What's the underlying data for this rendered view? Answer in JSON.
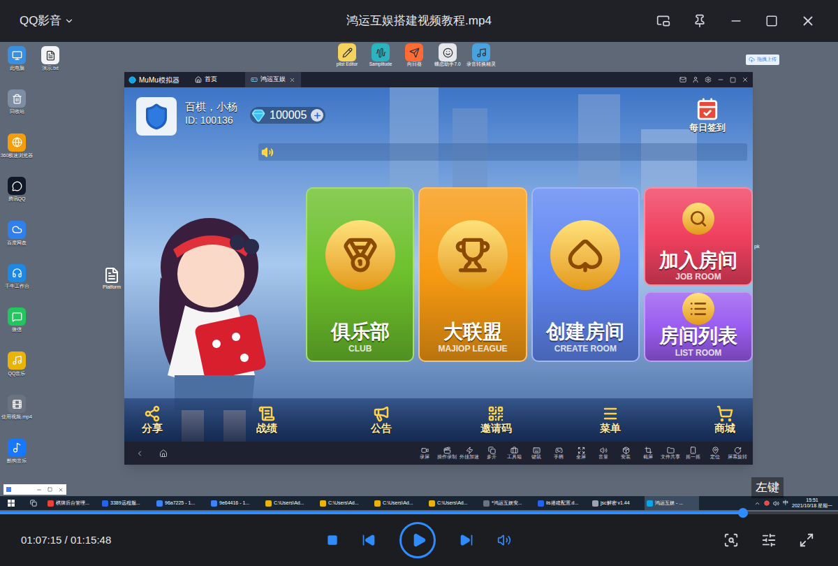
{
  "player": {
    "app_name": "QQ影音",
    "title": "鸿运互娱搭建视频教程.mp4",
    "time": "01:07:15 / 01:15:48",
    "progress": {
      "level": 0.887
    },
    "playing": false
  },
  "desktop": {
    "left_column": [
      "此电脑",
      "回收站",
      "360极速浏览器",
      "腾讯QQ",
      "百度网盘",
      "千牛工作台",
      "微信",
      "QQ音乐",
      "使用视频.mp4",
      "酷狗音乐"
    ],
    "second_column": [
      "演示.txt"
    ],
    "top_icons": [
      "plist Editor",
      "Samplitude",
      "向日葵",
      "蝶恋助手7.0",
      "录音转换精灵"
    ],
    "hidden_icon": "Platform",
    "partial_label": "pk",
    "upload_button": "拖拽上传"
  },
  "overlay_hint": "左键",
  "emulator": {
    "app_name": "MuMu模拟器",
    "tabs": [
      {
        "label": "首页",
        "selected": false
      },
      {
        "label": "鸿运互娱",
        "selected": true
      }
    ],
    "toolbar": [
      "录屏",
      "操作录制",
      "外挂加速",
      "多开",
      "工具箱",
      "键鼠",
      "手柄",
      "全屏",
      "音量",
      "安装",
      "截屏",
      "文件共享",
      "摇一摇",
      "定位",
      "屏幕旋转"
    ]
  },
  "game": {
    "player_name": "百棋，小杨",
    "player_id": "ID: 100136",
    "diamonds": "100005",
    "daily_sign": "每日签到",
    "cards": [
      {
        "title": "俱乐部",
        "subtitle": "CLUB",
        "color": "#6cc02c"
      },
      {
        "title": "大联盟",
        "subtitle": "MAJIOP LEAGUE",
        "color": "#f79a12"
      },
      {
        "title": "创建房间",
        "subtitle": "CREATE ROOM",
        "color": "#5f86f2"
      },
      {
        "title": "加入房间",
        "subtitle": "JOB ROOM",
        "color": "#f0405f"
      },
      {
        "title": "房间列表",
        "subtitle": "LIST ROOM",
        "color": "#9a5cf0"
      }
    ],
    "bottom_menu": [
      "分享",
      "战绩",
      "公告",
      "邀请码",
      "菜单",
      "商城"
    ]
  },
  "taskbar": {
    "items": [
      {
        "label": "棋牌后台管理...",
        "active": false
      },
      {
        "label": "3389远程服...",
        "active": false
      },
      {
        "label": "96a7225 - 1...",
        "active": false
      },
      {
        "label": "9e64416 - 1...",
        "active": false
      },
      {
        "label": "C:\\Users\\Ad...",
        "active": false
      },
      {
        "label": "C:\\Users\\Ad...",
        "active": false
      },
      {
        "label": "C:\\Users\\Ad...",
        "active": false
      },
      {
        "label": "C:\\Users\\Ad...",
        "active": false
      },
      {
        "label": "*鸿运互娱安...",
        "active": false
      },
      {
        "label": "iis搭建配置.d...",
        "active": false
      },
      {
        "label": "jsc解密 v1.44",
        "active": false
      },
      {
        "label": "鸿运互娱 - ...",
        "active": true
      }
    ],
    "ime": "中",
    "time": "15:51",
    "date": "2021/10/18 星期一"
  }
}
